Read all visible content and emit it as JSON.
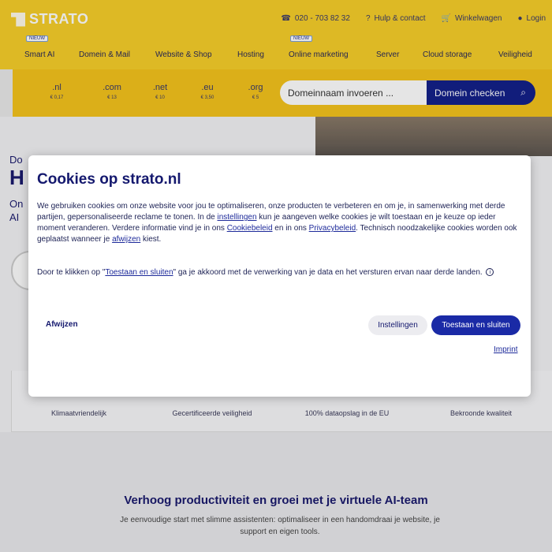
{
  "brand": {
    "name": "STRATO",
    "yellow": "#f7ce2a",
    "navy": "#14218a"
  },
  "top_links": [
    {
      "icon": "phone-icon",
      "label": "020 - 703 82 32"
    },
    {
      "icon": "help-icon",
      "label": "Hulp & contact"
    },
    {
      "icon": "cart-icon",
      "label": "Winkelwagen"
    },
    {
      "icon": "user-icon",
      "label": "Login"
    }
  ],
  "nav": {
    "items": [
      "Smart AI",
      "Domein & Mail",
      "Website & Shop",
      "Hosting",
      "Online marketing",
      "Server",
      "Cloud storage",
      "Veiligheid"
    ],
    "badge": "NIEUW"
  },
  "domains": {
    "tlds": [
      {
        "name": ".nl",
        "price": "€ 0,17"
      },
      {
        "name": ".com",
        "price": "€ 13"
      },
      {
        "name": ".net",
        "price": "€ 10"
      },
      {
        "name": ".eu",
        "price": "€ 3,50"
      },
      {
        "name": ".org",
        "price": "€ 5"
      }
    ],
    "input_placeholder": "Domeinnaam invoeren ...",
    "check_button": "Domein checken"
  },
  "hero": {
    "line1": "Do",
    "line2": "H",
    "line3": "On",
    "line4": "AI"
  },
  "features": [
    "Klimaatvriendelijk",
    "Gecertificeerde veiligheid",
    "100% dataopslag in de EU",
    "Bekroonde kwaliteit"
  ],
  "section": {
    "title": "Verhoog productiviteit en groei met je virtuele AI-team",
    "text": "Je eenvoudige start met slimme assistenten: optimaliseer in een handomdraai je website, je support en eigen tools."
  },
  "cookie_dialog": {
    "title": "Cookies op strato.nl",
    "body_1": "We gebruiken cookies om onze website voor jou te optimaliseren, onze producten te verbeteren en om je, in samenwerking met derde partijen, gepersonaliseerde reclame te tonen. In de ",
    "link_settings": "instellingen",
    "body_2": " kun je aangeven welke cookies je wilt toestaan en je keuze op ieder moment veranderen. Verdere informatie vind je in ons ",
    "link_policy": "Cookiebeleid",
    "body_3": " en in ons ",
    "link_privacy": "Privacybeleid",
    "body_4": ". Technisch noodzakelijke cookies worden ook geplaatst wanneer je ",
    "link_reject": "afwijzen",
    "body_5": " kiest.",
    "consent_1": "Door te klikken op \"",
    "consent_link": "Toestaan en sluiten",
    "consent_2": "\" ga je akkoord met de verwerking van je data en het versturen ervan naar derde landen.",
    "reject_button": "Afwijzen",
    "settings_button": "Instellingen",
    "accept_button": "Toestaan en sluiten",
    "imprint_link": "Imprint"
  }
}
